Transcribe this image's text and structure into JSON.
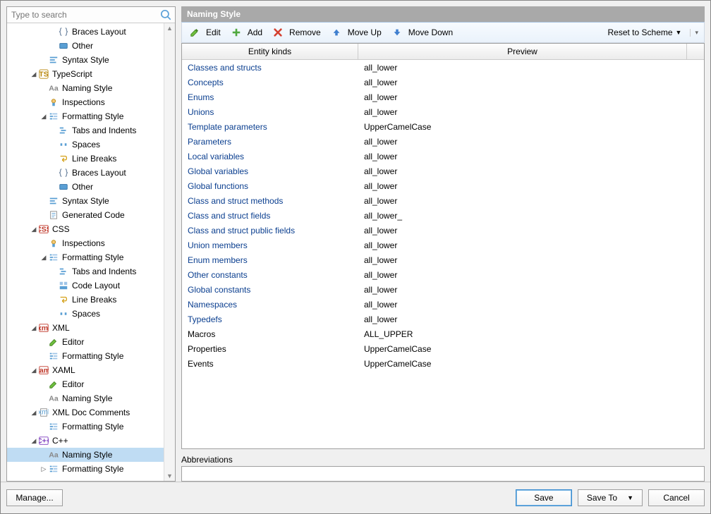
{
  "search": {
    "placeholder": "Type to search"
  },
  "panel_title": "Naming Style",
  "toolbar": {
    "edit": "Edit",
    "add": "Add",
    "remove": "Remove",
    "move_up": "Move Up",
    "move_down": "Move Down",
    "reset": "Reset to Scheme"
  },
  "table": {
    "headers": {
      "kinds": "Entity kinds",
      "preview": "Preview"
    },
    "rows": [
      {
        "k": "Classes and structs",
        "p": "all_lower",
        "link": true
      },
      {
        "k": "Concepts",
        "p": "all_lower",
        "link": true
      },
      {
        "k": "Enums",
        "p": "all_lower",
        "link": true
      },
      {
        "k": "Unions",
        "p": "all_lower",
        "link": true
      },
      {
        "k": "Template parameters",
        "p": "UpperCamelCase",
        "link": true
      },
      {
        "k": "Parameters",
        "p": "all_lower",
        "link": true
      },
      {
        "k": "Local variables",
        "p": "all_lower",
        "link": true
      },
      {
        "k": "Global variables",
        "p": "all_lower",
        "link": true
      },
      {
        "k": "Global functions",
        "p": "all_lower",
        "link": true
      },
      {
        "k": "Class and struct methods",
        "p": "all_lower",
        "link": true
      },
      {
        "k": "Class and struct fields",
        "p": "all_lower_",
        "link": true
      },
      {
        "k": "Class and struct public fields",
        "p": "all_lower",
        "link": true
      },
      {
        "k": "Union members",
        "p": "all_lower",
        "link": true
      },
      {
        "k": "Enum members",
        "p": "all_lower",
        "link": true
      },
      {
        "k": "Other constants",
        "p": "all_lower",
        "link": true
      },
      {
        "k": "Global constants",
        "p": "all_lower",
        "link": true
      },
      {
        "k": "Namespaces",
        "p": "all_lower",
        "link": true
      },
      {
        "k": "Typedefs",
        "p": "all_lower",
        "link": true
      },
      {
        "k": "Macros",
        "p": "ALL_UPPER",
        "link": false
      },
      {
        "k": "Properties",
        "p": "UpperCamelCase",
        "link": false
      },
      {
        "k": "Events",
        "p": "UpperCamelCase",
        "link": false
      }
    ]
  },
  "abbrev": {
    "label": "Abbreviations",
    "value": ""
  },
  "footer": {
    "manage": "Manage...",
    "save": "Save",
    "save_to": "Save To",
    "cancel": "Cancel"
  },
  "tree": [
    {
      "d": 4,
      "icon": "braces",
      "label": "Braces Layout"
    },
    {
      "d": 4,
      "icon": "other",
      "label": "Other"
    },
    {
      "d": 3,
      "icon": "syntax",
      "label": "Syntax Style"
    },
    {
      "d": 2,
      "icon": "ts",
      "label": "TypeScript",
      "exp": true
    },
    {
      "d": 3,
      "icon": "aa",
      "label": "Naming Style"
    },
    {
      "d": 3,
      "icon": "inspect",
      "label": "Inspections"
    },
    {
      "d": 3,
      "icon": "format",
      "label": "Formatting Style",
      "exp": true
    },
    {
      "d": 4,
      "icon": "tabs",
      "label": "Tabs and Indents"
    },
    {
      "d": 4,
      "icon": "spaces",
      "label": "Spaces"
    },
    {
      "d": 4,
      "icon": "linebreak",
      "label": "Line Breaks"
    },
    {
      "d": 4,
      "icon": "braces",
      "label": "Braces Layout"
    },
    {
      "d": 4,
      "icon": "other",
      "label": "Other"
    },
    {
      "d": 3,
      "icon": "syntax",
      "label": "Syntax Style"
    },
    {
      "d": 3,
      "icon": "gen",
      "label": "Generated Code"
    },
    {
      "d": 2,
      "icon": "css",
      "label": "CSS",
      "exp": true
    },
    {
      "d": 3,
      "icon": "inspect",
      "label": "Inspections"
    },
    {
      "d": 3,
      "icon": "format",
      "label": "Formatting Style",
      "exp": true
    },
    {
      "d": 4,
      "icon": "tabs",
      "label": "Tabs and Indents"
    },
    {
      "d": 4,
      "icon": "codelayout",
      "label": "Code Layout"
    },
    {
      "d": 4,
      "icon": "linebreak",
      "label": "Line Breaks"
    },
    {
      "d": 4,
      "icon": "spaces",
      "label": "Spaces"
    },
    {
      "d": 2,
      "icon": "xml",
      "label": "XML",
      "exp": true
    },
    {
      "d": 3,
      "icon": "pencil",
      "label": "Editor"
    },
    {
      "d": 3,
      "icon": "format",
      "label": "Formatting Style"
    },
    {
      "d": 2,
      "icon": "xaml",
      "label": "XAML",
      "exp": true
    },
    {
      "d": 3,
      "icon": "pencil",
      "label": "Editor"
    },
    {
      "d": 3,
      "icon": "aa",
      "label": "Naming Style"
    },
    {
      "d": 2,
      "icon": "xmldoc",
      "label": "XML Doc Comments",
      "exp": true
    },
    {
      "d": 3,
      "icon": "format",
      "label": "Formatting Style"
    },
    {
      "d": 2,
      "icon": "cpp",
      "label": "C++",
      "exp": true
    },
    {
      "d": 3,
      "icon": "aa",
      "label": "Naming Style",
      "selected": true
    },
    {
      "d": 3,
      "icon": "format",
      "label": "Formatting Style",
      "col": true
    }
  ]
}
